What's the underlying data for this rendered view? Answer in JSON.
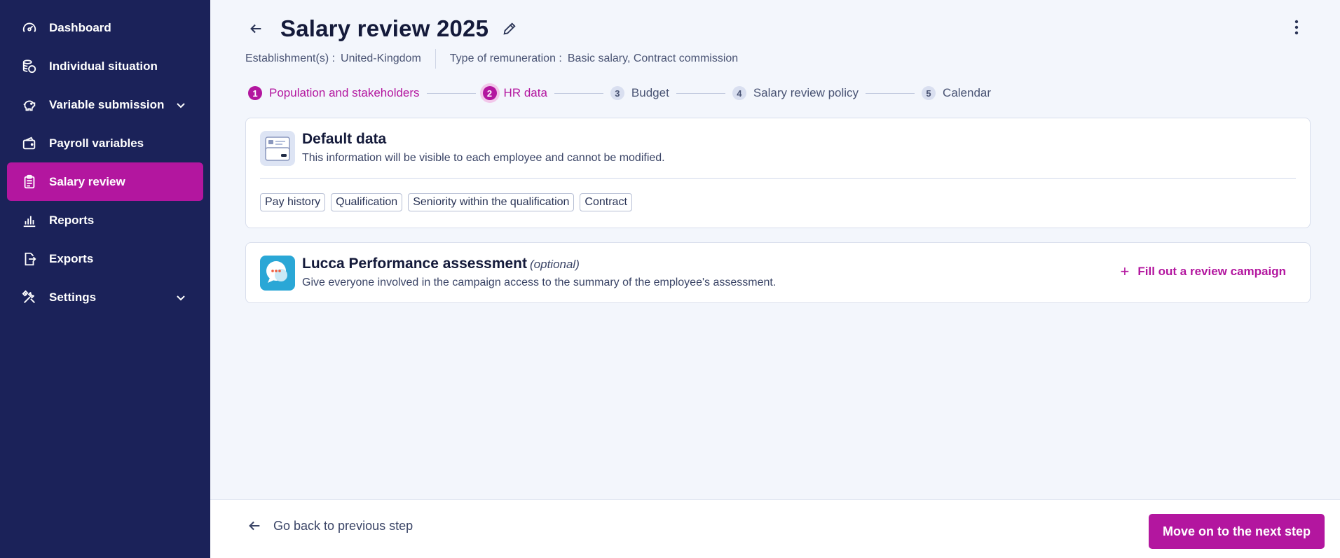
{
  "sidebar": {
    "items": [
      {
        "label": "Dashboard",
        "icon": "dashboard-icon"
      },
      {
        "label": "Individual situation",
        "icon": "coins-icon"
      },
      {
        "label": "Variable submission",
        "icon": "piggy-bank-icon",
        "expandable": true
      },
      {
        "label": "Payroll variables",
        "icon": "wallet-icon"
      },
      {
        "label": "Salary review",
        "icon": "clipboard-icon",
        "active": true
      },
      {
        "label": "Reports",
        "icon": "bar-chart-icon"
      },
      {
        "label": "Exports",
        "icon": "export-icon"
      },
      {
        "label": "Settings",
        "icon": "tools-icon",
        "expandable": true
      }
    ]
  },
  "header": {
    "title": "Salary review 2025",
    "establishment_label": "Establishment(s) :",
    "establishment_value": "United-Kingdom",
    "remuneration_label": "Type of remuneration :",
    "remuneration_value": "Basic salary, Contract commission"
  },
  "stepper": {
    "steps": [
      {
        "num": "1",
        "label": "Population and stakeholders",
        "state": "done"
      },
      {
        "num": "2",
        "label": "HR data",
        "state": "current"
      },
      {
        "num": "3",
        "label": "Budget",
        "state": "todo"
      },
      {
        "num": "4",
        "label": "Salary review policy",
        "state": "todo"
      },
      {
        "num": "5",
        "label": "Calendar",
        "state": "todo"
      }
    ]
  },
  "default_data": {
    "title": "Default data",
    "description": "This information will be visible to each employee and cannot be modified.",
    "tags": [
      "Pay history",
      "Qualification",
      "Seniority within the qualification",
      "Contract"
    ]
  },
  "performance": {
    "title": "Lucca Performance assessment",
    "optional": "(optional)",
    "description": "Give everyone involved in the campaign access to the summary of the employee's assessment.",
    "action": "Fill out a review campaign"
  },
  "footer": {
    "prev_label": "Go back to previous step",
    "next_label": "Move on to the next step"
  },
  "colors": {
    "sidebar_bg": "#1b2259",
    "accent": "#b3169f",
    "page_bg": "#f3f6fc"
  }
}
